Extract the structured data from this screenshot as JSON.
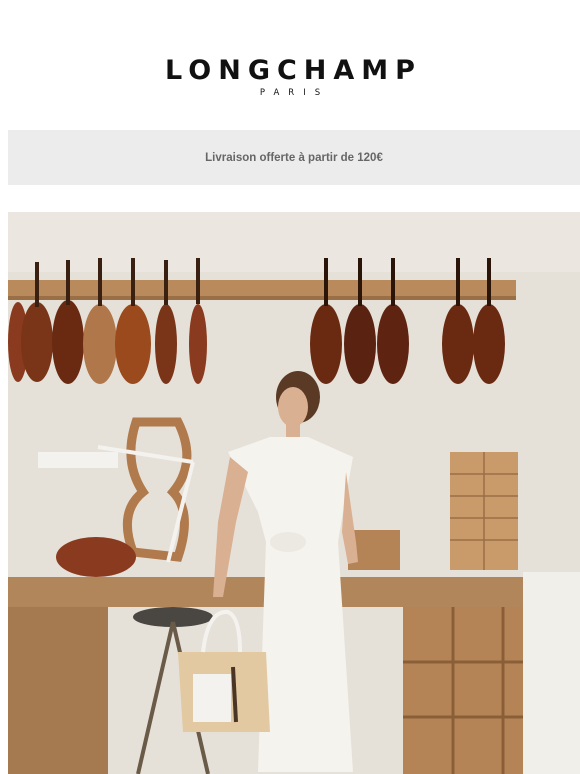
{
  "brand": {
    "name": "LONGCHAMP",
    "subtitle": "PARIS"
  },
  "banner": {
    "text": "Livraison offerte à partir de 120€"
  },
  "hero": {
    "image_description": "Woman in white dress holding a canvas tote bag in a violin maker's workshop"
  },
  "colors": {
    "banner_bg": "#ececec",
    "banner_text": "#666666",
    "logo": "#111111"
  }
}
